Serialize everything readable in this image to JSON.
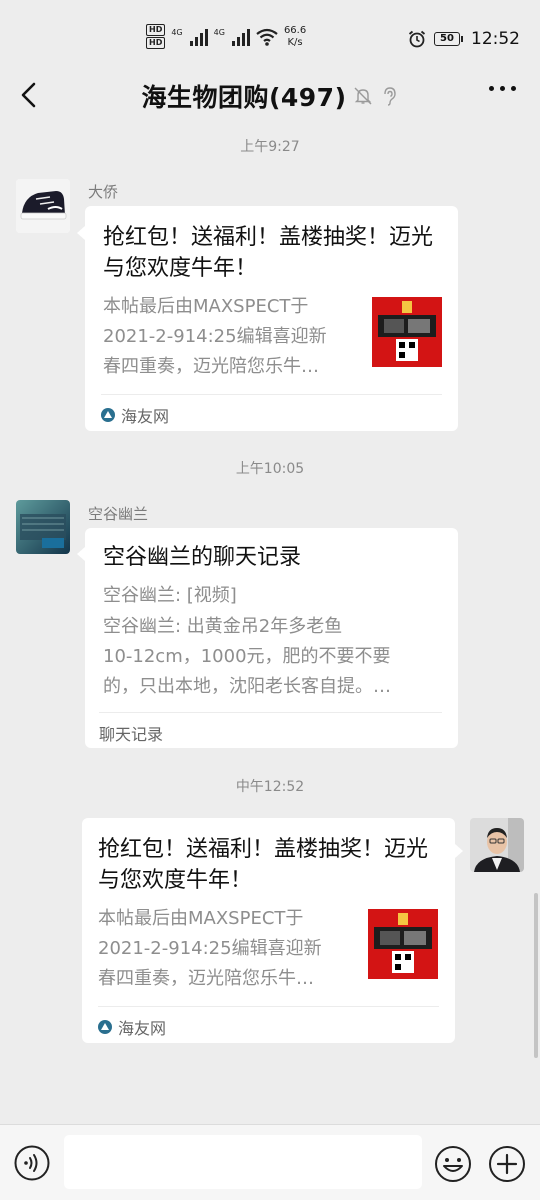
{
  "status_bar": {
    "hd1": "HD",
    "hd2": "HD",
    "net1": "4G",
    "net2": "4G",
    "speed_value": "66.6",
    "speed_unit": "K/s",
    "battery": "50",
    "clock": "12:52",
    "icons": [
      "hd-icon",
      "signal-icon",
      "wifi-icon",
      "alarm-icon",
      "battery-icon"
    ]
  },
  "nav": {
    "title": "海生物团购(497)",
    "icons": [
      "back-icon",
      "mute-bell-icon",
      "ear-icon",
      "more-icon"
    ]
  },
  "messages": [
    {
      "time": "上午9:27",
      "sender": "大侨",
      "card": {
        "title": "抢红包！送福利！盖楼抽奖！迈光与您欢度牛年！",
        "desc1": "本帖最后由MAXSPECT于",
        "desc2": "2021-2-914:25编辑喜迎新",
        "desc3": "春四重奏，迈光陪您乐牛…",
        "source": "海友网"
      }
    },
    {
      "time": "上午10:05",
      "sender": "空谷幽兰",
      "record": {
        "title": "空谷幽兰的聊天记录",
        "line1": "空谷幽兰: [视频]",
        "line2": "空谷幽兰: 出黄金吊2年多老鱼",
        "line3": "10-12cm，1000元，肥的不要不要",
        "line4": "的，只出本地，沈阳老长客自提。…",
        "footer": "聊天记录"
      }
    },
    {
      "time": "中午12:52",
      "card": {
        "title": "抢红包！送福利！盖楼抽奖！迈光与您欢度牛年！",
        "desc1": "本帖最后由MAXSPECT于",
        "desc2": "2021-2-914:25编辑喜迎新",
        "desc3": "春四重奏，迈光陪您乐牛…",
        "source": "海友网"
      }
    }
  ],
  "input_bar": {
    "placeholder": "",
    "icons": [
      "voice-icon",
      "emoji-icon",
      "plus-icon"
    ]
  }
}
